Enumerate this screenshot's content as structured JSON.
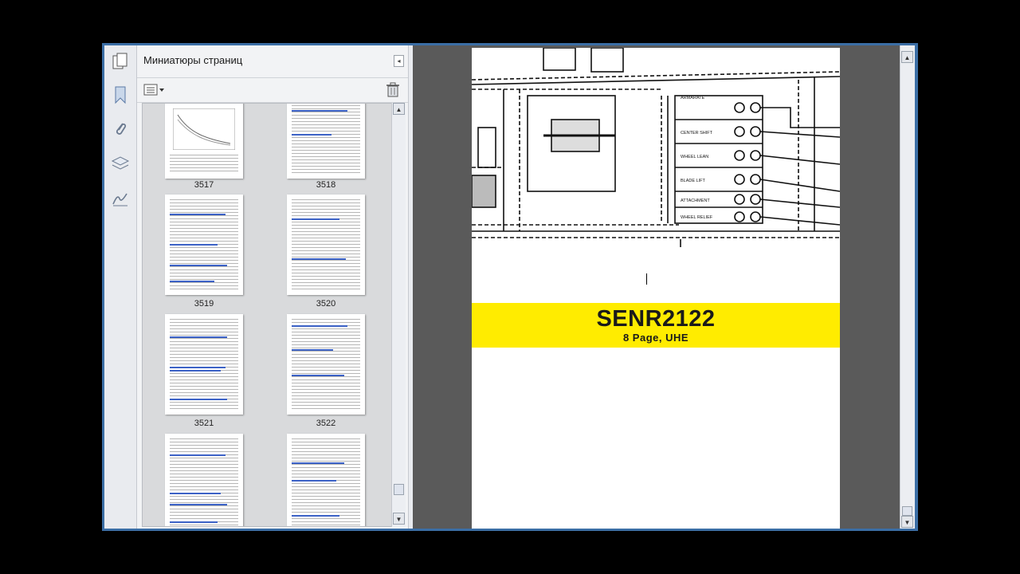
{
  "sidebar": {
    "title": "Миниатюры страниц",
    "collapse_glyph": "◂",
    "tools": [
      "pages-icon",
      "bookmark-icon",
      "attachment-icon",
      "layers-icon",
      "signature-icon"
    ]
  },
  "thumbnails": [
    {
      "label": "3517"
    },
    {
      "label": "3518"
    },
    {
      "label": "3519"
    },
    {
      "label": "3520"
    },
    {
      "label": "3521"
    },
    {
      "label": "3522"
    },
    {
      "label": ""
    },
    {
      "label": ""
    }
  ],
  "document": {
    "title": "SENR2122",
    "subtitle": "8 Page, UHE"
  },
  "diagram_labels": [
    "ARMARATE",
    "CENTER SHIFT",
    "WHEEL LEAN",
    "BLADE LIFT",
    "ATTACHMENT",
    "WHEEL RELIEF"
  ]
}
